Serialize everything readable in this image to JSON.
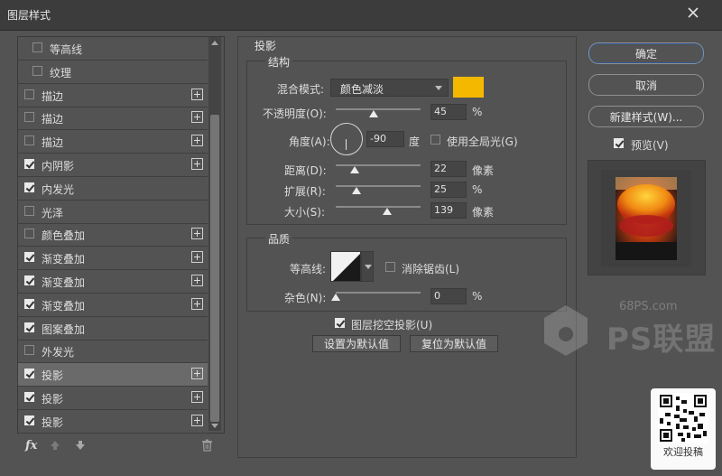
{
  "window": {
    "title": "图层样式"
  },
  "style_list": [
    {
      "label": "等高线",
      "checked": false,
      "indent": true,
      "plus": false,
      "selected": false
    },
    {
      "label": "纹理",
      "checked": false,
      "indent": true,
      "plus": false,
      "selected": false
    },
    {
      "label": "描边",
      "checked": false,
      "indent": false,
      "plus": true,
      "selected": false
    },
    {
      "label": "描边",
      "checked": false,
      "indent": false,
      "plus": true,
      "selected": false
    },
    {
      "label": "描边",
      "checked": false,
      "indent": false,
      "plus": true,
      "selected": false
    },
    {
      "label": "内阴影",
      "checked": true,
      "indent": false,
      "plus": true,
      "selected": false
    },
    {
      "label": "内发光",
      "checked": true,
      "indent": false,
      "plus": false,
      "selected": false
    },
    {
      "label": "光泽",
      "checked": false,
      "indent": false,
      "plus": false,
      "selected": false
    },
    {
      "label": "颜色叠加",
      "checked": false,
      "indent": false,
      "plus": true,
      "selected": false
    },
    {
      "label": "渐变叠加",
      "checked": true,
      "indent": false,
      "plus": true,
      "selected": false
    },
    {
      "label": "渐变叠加",
      "checked": true,
      "indent": false,
      "plus": true,
      "selected": false
    },
    {
      "label": "渐变叠加",
      "checked": true,
      "indent": false,
      "plus": true,
      "selected": false
    },
    {
      "label": "图案叠加",
      "checked": true,
      "indent": false,
      "plus": false,
      "selected": false
    },
    {
      "label": "外发光",
      "checked": false,
      "indent": false,
      "plus": false,
      "selected": false
    },
    {
      "label": "投影",
      "checked": true,
      "indent": false,
      "plus": true,
      "selected": true
    },
    {
      "label": "投影",
      "checked": true,
      "indent": false,
      "plus": true,
      "selected": false
    },
    {
      "label": "投影",
      "checked": true,
      "indent": false,
      "plus": true,
      "selected": false
    }
  ],
  "bottom_icons": {
    "fx": "fx",
    "up": "arrow-up-icon",
    "down": "arrow-down-icon",
    "trash": "trash-icon"
  },
  "panel": {
    "title": "投影",
    "structure": {
      "header": "结构",
      "blend_mode_label": "混合模式:",
      "blend_mode_value": "颜色减淡",
      "color": "#f5b800",
      "opacity_label": "不透明度(O):",
      "opacity_value": "45",
      "opacity_unit": "%",
      "opacity_level": 0.45,
      "angle_label": "角度(A):",
      "angle_value": "-90",
      "angle_unit": "度",
      "global_light_label": "使用全局光(G)",
      "global_light_checked": false,
      "distance_label": "距离(D):",
      "distance_value": "22",
      "distance_unit": "像素",
      "spread_label": "扩展(R):",
      "spread_value": "25",
      "spread_unit": "%",
      "size_label": "大小(S):",
      "size_value": "139",
      "size_unit": "像素"
    },
    "quality": {
      "header": "品质",
      "contour_label": "等高线:",
      "antialias_label": "消除锯齿(L)",
      "antialias_checked": false,
      "noise_label": "杂色(N):",
      "noise_value": "0",
      "noise_unit": "%"
    },
    "knockout_label": "图层挖空投影(U)",
    "knockout_checked": true,
    "make_default": "设置为默认值",
    "reset_default": "复位为默认值"
  },
  "buttons": {
    "ok": "确定",
    "cancel": "取消",
    "new_style": "新建样式(W)...",
    "preview_label": "预览(V)",
    "preview_checked": true
  },
  "watermark": {
    "site": "68PS.com",
    "brand": "PS联盟"
  },
  "qr": {
    "caption": "欢迎投稿"
  }
}
